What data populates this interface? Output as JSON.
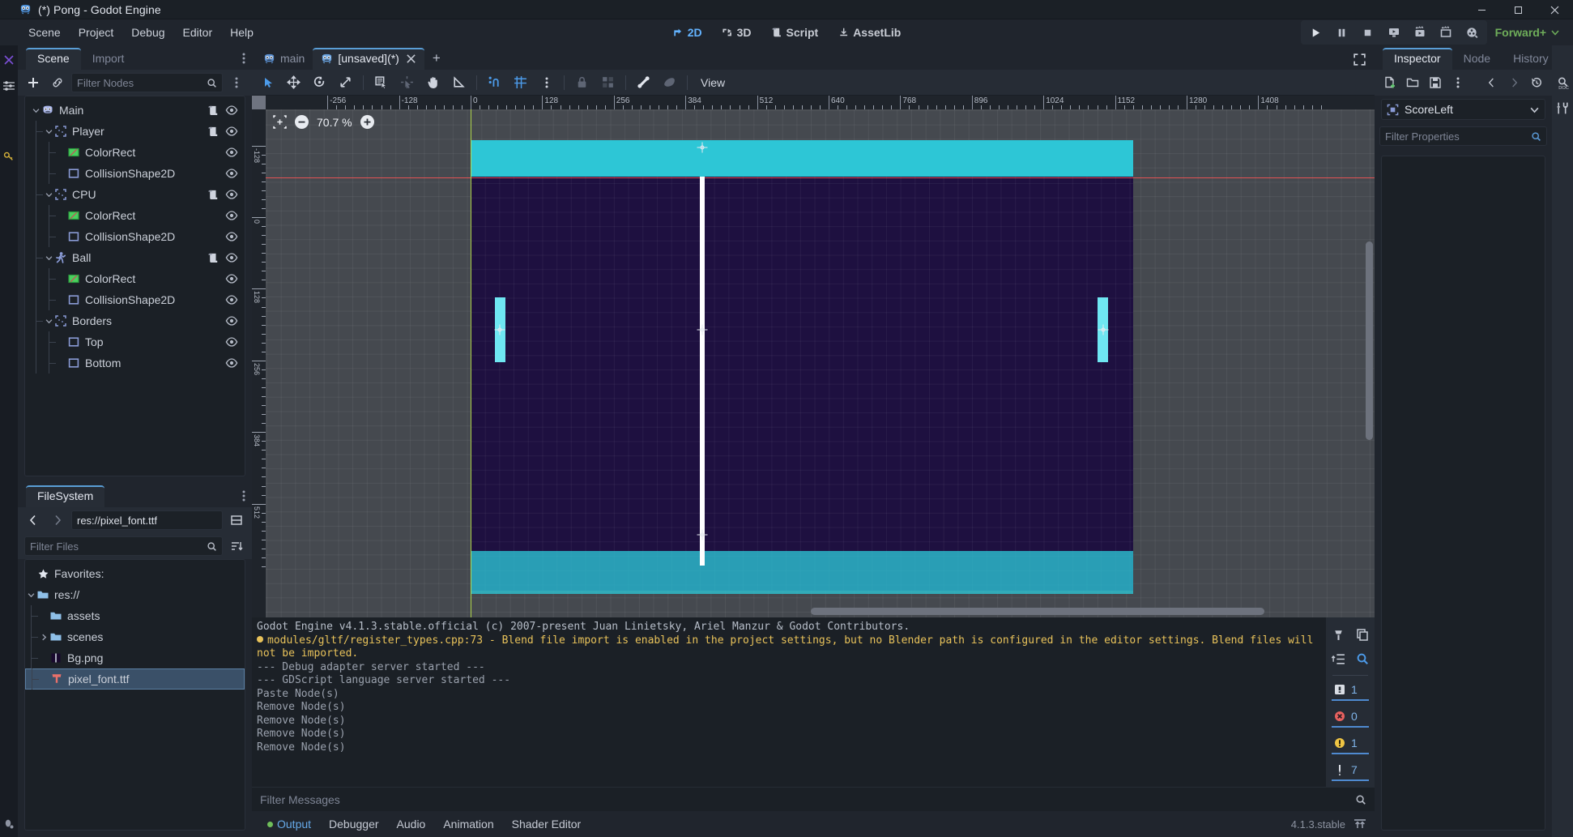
{
  "window": {
    "title": "(*) Pong - Godot Engine",
    "app_icon": "godot-robot-icon",
    "minimize": "–",
    "maximize": "☐",
    "close": "✕"
  },
  "menubar": {
    "items": [
      "Scene",
      "Project",
      "Debug",
      "Editor",
      "Help"
    ]
  },
  "main_tabs": {
    "items": [
      {
        "label": "2D",
        "icon": "2d-icon",
        "active": true
      },
      {
        "label": "3D",
        "icon": "3d-icon",
        "active": false
      },
      {
        "label": "Script",
        "icon": "script-icon",
        "active": false
      },
      {
        "label": "AssetLib",
        "icon": "assetlib-icon",
        "active": false
      }
    ]
  },
  "run_toolbar": {
    "buttons": [
      {
        "name": "play-scene-button",
        "icon": "play-icon"
      },
      {
        "name": "pause-button",
        "icon": "pause-icon"
      },
      {
        "name": "stop-button",
        "icon": "stop-icon"
      },
      {
        "name": "play-current-scene-button",
        "icon": "play-monitor-icon"
      },
      {
        "name": "play-custom-scene-button",
        "icon": "play-movie-icon"
      },
      {
        "name": "movie-writer-button",
        "icon": "movie-camera-icon"
      },
      {
        "name": "remote-debug-button",
        "icon": "film-reel-icon"
      }
    ],
    "renderer": "Forward+",
    "renderer_color": "#6fae5a"
  },
  "scene_dock": {
    "tabs": [
      {
        "label": "Scene",
        "active": true
      },
      {
        "label": "Import",
        "active": false
      }
    ],
    "toolbar": {
      "add_node": "+",
      "instantiate": "link-icon",
      "filter_placeholder": "Filter Nodes",
      "search_icon": "search-icon",
      "menu_icon": "kebab-menu-icon"
    },
    "nodes": [
      {
        "label": "Main",
        "depth": 0,
        "icon": "node2d-robot-icon",
        "expanded": true,
        "script": true,
        "visibility": true
      },
      {
        "label": "Player",
        "depth": 1,
        "icon": "area2d-icon",
        "expanded": true,
        "script": true,
        "visibility": true
      },
      {
        "label": "ColorRect",
        "depth": 2,
        "icon": "colorrect-icon",
        "expanded": null,
        "script": false,
        "visibility": true
      },
      {
        "label": "CollisionShape2D",
        "depth": 2,
        "icon": "collisionshape-icon",
        "expanded": null,
        "script": false,
        "visibility": true
      },
      {
        "label": "CPU",
        "depth": 1,
        "icon": "area2d-icon",
        "expanded": true,
        "script": true,
        "visibility": true
      },
      {
        "label": "ColorRect",
        "depth": 2,
        "icon": "colorrect-icon",
        "expanded": null,
        "script": false,
        "visibility": true
      },
      {
        "label": "CollisionShape2D",
        "depth": 2,
        "icon": "collisionshape-icon",
        "expanded": null,
        "script": false,
        "visibility": true
      },
      {
        "label": "Ball",
        "depth": 1,
        "icon": "characterbody-icon",
        "expanded": true,
        "script": true,
        "visibility": true
      },
      {
        "label": "ColorRect",
        "depth": 2,
        "icon": "colorrect-icon",
        "expanded": null,
        "script": false,
        "visibility": true
      },
      {
        "label": "CollisionShape2D",
        "depth": 2,
        "icon": "collisionshape-icon",
        "expanded": null,
        "script": false,
        "visibility": true
      },
      {
        "label": "Borders",
        "depth": 1,
        "icon": "area2d-icon",
        "expanded": true,
        "script": false,
        "visibility": true
      },
      {
        "label": "Top",
        "depth": 2,
        "icon": "collisionshape-icon",
        "expanded": null,
        "script": false,
        "visibility": true
      },
      {
        "label": "Bottom",
        "depth": 2,
        "icon": "collisionshape-icon",
        "expanded": null,
        "script": false,
        "visibility": true
      }
    ]
  },
  "filesystem_dock": {
    "tab": "FileSystem",
    "path": "res://pixel_font.ttf",
    "back_icon": "chevron-left-icon",
    "forward_icon": "chevron-right-icon",
    "split_icon": "toggle-split-mode-icon",
    "filter_placeholder": "Filter Files",
    "sort_icon": "sort-icon",
    "entries": [
      {
        "label": "Favorites:",
        "depth": 0,
        "icon": "star-icon",
        "expanded": null,
        "selected": false
      },
      {
        "label": "res://",
        "depth": 0,
        "icon": "folder-icon",
        "expanded": true,
        "selected": false
      },
      {
        "label": "assets",
        "depth": 1,
        "icon": "folder-icon",
        "expanded": null,
        "selected": false
      },
      {
        "label": "scenes",
        "depth": 1,
        "icon": "folder-icon",
        "expanded": false,
        "selected": false
      },
      {
        "label": "Bg.png",
        "depth": 1,
        "icon": "image-file-icon",
        "expanded": null,
        "selected": false
      },
      {
        "label": "pixel_font.ttf",
        "depth": 1,
        "icon": "font-file-icon",
        "expanded": null,
        "selected": true
      }
    ]
  },
  "scene_tabs": {
    "tabs": [
      {
        "label": "main",
        "icon": "scene-robot-icon",
        "active": false,
        "closable": false
      },
      {
        "label": "[unsaved](*)",
        "icon": "scene-robot-icon",
        "active": true,
        "closable": true,
        "close_icon": "close-icon"
      }
    ],
    "add_tab": "+",
    "fullscreen_icon": "distraction-free-icon"
  },
  "canvas_toolbar": {
    "tools": [
      {
        "name": "select-mode-button",
        "icon": "cursor-arrow-icon",
        "state": "active"
      },
      {
        "name": "move-mode-button",
        "icon": "move-icon",
        "state": "normal"
      },
      {
        "name": "rotate-mode-button",
        "icon": "rotate-icon",
        "state": "normal"
      },
      {
        "name": "scale-mode-button",
        "icon": "scale-icon",
        "state": "normal"
      },
      {
        "name": "list-select-button",
        "icon": "list-select-icon",
        "state": "normal"
      },
      {
        "name": "ruler-mode-button",
        "icon": "ruler-pointer-icon",
        "state": "dim"
      },
      {
        "name": "pan-mode-button",
        "icon": "hand-icon",
        "state": "normal"
      },
      {
        "name": "ruler-tool-button",
        "icon": "triangle-ruler-icon",
        "state": "normal"
      },
      {
        "name": "snap-mode-button",
        "icon": "smart-snap-icon",
        "state": "active"
      },
      {
        "name": "grid-snap-button",
        "icon": "grid-snap-icon",
        "state": "active"
      },
      {
        "name": "snap-options-button",
        "icon": "kebab-menu-icon",
        "state": "normal"
      },
      {
        "name": "lock-button",
        "icon": "lock-icon",
        "state": "dim"
      },
      {
        "name": "group-button",
        "icon": "group-icon",
        "state": "dim"
      },
      {
        "name": "skeleton-button",
        "icon": "bone-icon",
        "state": "normal"
      },
      {
        "name": "preview-button",
        "icon": "paint-icon",
        "state": "dim"
      }
    ],
    "view_menu": "View"
  },
  "viewport": {
    "zoom": "70.7 %",
    "zoom_out_icon": "minus-icon",
    "zoom_in_icon": "plus-icon",
    "center_icon": "center-view-icon",
    "ruler_labels_h": [
      "-256",
      "-128",
      "0",
      "128",
      "256",
      "384",
      "512",
      "640",
      "768",
      "896",
      "1024",
      "1152",
      "1280",
      "1408"
    ],
    "ruler_labels_v": [
      "-128",
      "0",
      "128",
      "256",
      "384",
      "512"
    ]
  },
  "inspector": {
    "tabs": [
      {
        "label": "Inspector",
        "active": true
      },
      {
        "label": "Node",
        "active": false
      },
      {
        "label": "History",
        "active": false
      }
    ],
    "menu_icon": "kebab-menu-icon",
    "toolbar": [
      {
        "name": "new-resource-button",
        "icon": "new-resource-icon"
      },
      {
        "name": "load-resource-button",
        "icon": "folder-open-icon"
      },
      {
        "name": "save-resource-button",
        "icon": "save-icon"
      },
      {
        "name": "resource-menu-button",
        "icon": "kebab-menu-icon"
      },
      {
        "name": "history-back-button",
        "icon": "chevron-left-icon"
      },
      {
        "name": "history-forward-button",
        "icon": "chevron-right-icon"
      },
      {
        "name": "history-button",
        "icon": "history-icon"
      }
    ],
    "selected_node": "ScoreLeft",
    "selected_node_icon": "label-node-icon",
    "expand_icon": "chevron-down-icon",
    "doc_icon": "open-docs-icon",
    "tools_icon": "object-tools-icon",
    "filter_placeholder": "Filter Properties",
    "search_icon": "search-icon"
  },
  "output": {
    "lines": [
      {
        "text": "Godot Engine v4.1.3.stable.official (c) 2007-present Juan Linietsky, Ariel Manzur & Godot Contributors.",
        "type": "head"
      },
      {
        "text": "modules/gltf/register_types.cpp:73 - Blend file import is enabled in the project settings, but no Blender path is configured in the editor settings. Blend files will not be imported.",
        "type": "warn"
      },
      {
        "text": "--- Debug adapter server started ---",
        "type": "normal"
      },
      {
        "text": "--- GDScript language server started ---",
        "type": "normal"
      },
      {
        "text": "Paste Node(s)",
        "type": "normal"
      },
      {
        "text": "Remove Node(s)",
        "type": "normal"
      },
      {
        "text": "Remove Node(s)",
        "type": "normal"
      },
      {
        "text": "Remove Node(s)",
        "type": "normal"
      },
      {
        "text": "Remove Node(s)",
        "type": "normal"
      }
    ],
    "side_buttons": [
      {
        "name": "clear-output-button",
        "icon": "clear-icon"
      },
      {
        "name": "copy-output-button",
        "icon": "copy-icon"
      },
      {
        "name": "collapse-button",
        "icon": "collapse-icon"
      },
      {
        "name": "search-output-button",
        "icon": "search-icon"
      }
    ],
    "counters": [
      {
        "name": "log-count",
        "icon": "log-icon",
        "value": "1"
      },
      {
        "name": "error-count",
        "icon": "error-icon",
        "value": "0"
      },
      {
        "name": "warning-count",
        "icon": "warning-icon",
        "value": "1"
      },
      {
        "name": "editor-count",
        "icon": "editor-icon",
        "value": "7"
      }
    ],
    "filter_placeholder": "Filter Messages",
    "filter_search_icon": "search-icon"
  },
  "bottom_bar": {
    "tabs": [
      {
        "label": "Output",
        "active": true,
        "dot": true
      },
      {
        "label": "Debugger",
        "active": false,
        "dot": false
      },
      {
        "label": "Audio",
        "active": false,
        "dot": false
      },
      {
        "label": "Animation",
        "active": false,
        "dot": false
      },
      {
        "label": "Shader Editor",
        "active": false,
        "dot": false
      }
    ],
    "version": "4.1.3.stable",
    "expand_icon": "expand-bottom-panel-icon"
  },
  "colors": {
    "accent": "#5a9ed6",
    "warning": "#e8c25a",
    "error": "#e25c5c",
    "renderer": "#6fae5a",
    "game_bg": "#1e1040",
    "band": "#2dc6d6",
    "paddle": "#6fe6f2"
  }
}
